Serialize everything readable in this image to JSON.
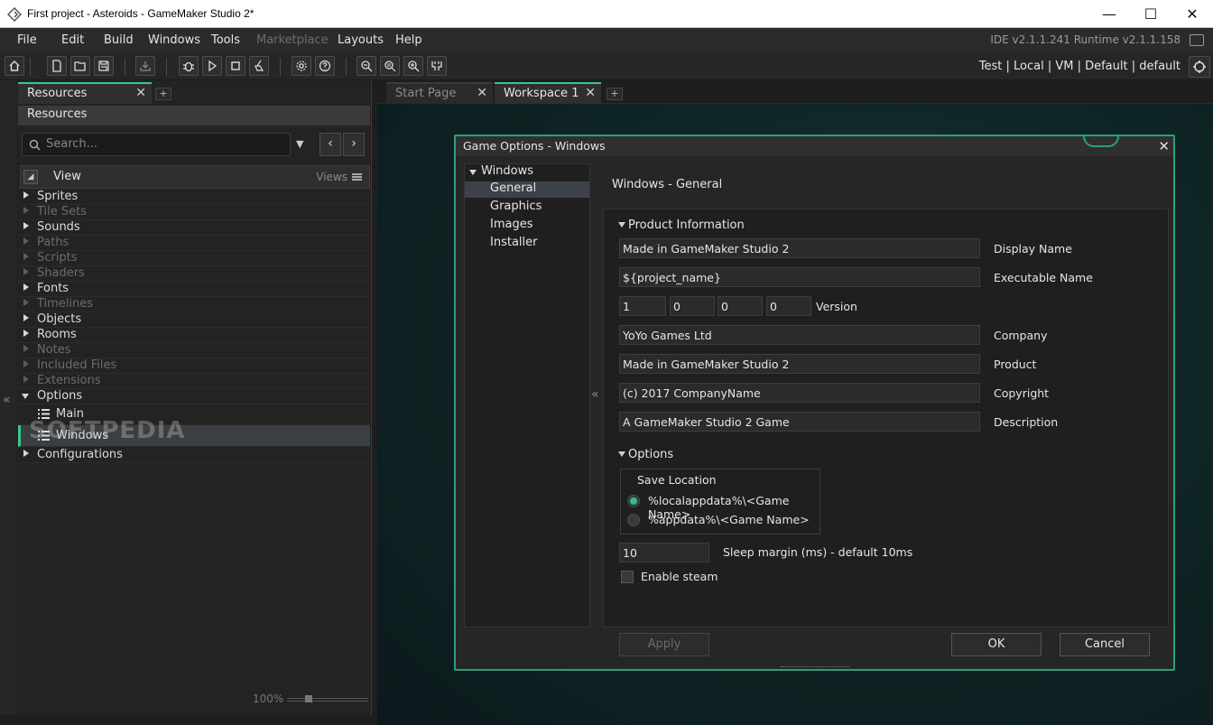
{
  "window": {
    "title": "First project - Asteroids - GameMaker Studio 2*",
    "minimize": "—",
    "maximize": "☐",
    "close": "✕"
  },
  "menu": {
    "items": [
      "File",
      "Edit",
      "Build",
      "Windows",
      "Tools",
      "Marketplace",
      "Layouts",
      "Help"
    ],
    "version": "IDE v2.1.1.241 Runtime v2.1.1.158"
  },
  "toolbar": {
    "target_label": "Test  |  Local  |  VM  |  Default  |  default",
    "icons": [
      "home-icon",
      "new-file-icon",
      "open-folder-icon",
      "save-icon",
      "create-exe-icon",
      "debug-icon",
      "run-icon",
      "stop-icon",
      "clean-icon",
      "settings-icon",
      "help-icon",
      "zoom-out-icon",
      "zoom-reset-icon",
      "zoom-in-icon",
      "game-options-icon"
    ]
  },
  "left_panel": {
    "tab_label": "Resources",
    "header": "Resources",
    "search_placeholder": "Search...",
    "view_label": "View",
    "views_label": "Views",
    "tree": [
      {
        "label": "Sprites",
        "enabled": true
      },
      {
        "label": "Tile Sets",
        "enabled": false
      },
      {
        "label": "Sounds",
        "enabled": true
      },
      {
        "label": "Paths",
        "enabled": false
      },
      {
        "label": "Scripts",
        "enabled": false
      },
      {
        "label": "Shaders",
        "enabled": false
      },
      {
        "label": "Fonts",
        "enabled": true
      },
      {
        "label": "Timelines",
        "enabled": false
      },
      {
        "label": "Objects",
        "enabled": true
      },
      {
        "label": "Rooms",
        "enabled": true
      },
      {
        "label": "Notes",
        "enabled": false
      },
      {
        "label": "Included Files",
        "enabled": false
      },
      {
        "label": "Extensions",
        "enabled": false
      },
      {
        "label": "Options",
        "enabled": true,
        "open": true
      }
    ],
    "options_children": [
      "Main",
      "Windows"
    ],
    "configurations": "Configurations",
    "watermark": "SOFTPEDIA",
    "zoom": "100%"
  },
  "workspace": {
    "tabs": [
      {
        "label": "Start Page",
        "active": false
      },
      {
        "label": "Workspace 1",
        "active": true
      }
    ]
  },
  "dialog": {
    "title": "Game Options - Windows",
    "nav_root": "Windows",
    "nav_items": [
      "General",
      "Graphics",
      "Images",
      "Installer"
    ],
    "heading": "Windows - General",
    "product_section": "Product Information",
    "display_name": {
      "value": "Made in GameMaker Studio 2",
      "label": "Display Name"
    },
    "executable_name": {
      "value": "${project_name}",
      "label": "Executable Name"
    },
    "version": {
      "parts": [
        "1",
        "0",
        "0",
        "0"
      ],
      "label": "Version"
    },
    "company": {
      "value": "YoYo Games Ltd",
      "label": "Company"
    },
    "product": {
      "value": "Made in GameMaker Studio 2",
      "label": "Product"
    },
    "copyright": {
      "value": "(c) 2017 CompanyName",
      "label": "Copyright"
    },
    "description": {
      "value": "A GameMaker Studio 2 Game",
      "label": "Description"
    },
    "options_section": "Options",
    "save_location_label": "Save Location",
    "save_options": [
      "%localappdata%\\<Game Name>",
      "%appdata%\\<Game Name>"
    ],
    "sleep_margin": {
      "value": "10",
      "label": "Sleep margin (ms) - default 10ms"
    },
    "enable_steam": "Enable steam",
    "buttons": {
      "apply": "Apply",
      "ok": "OK",
      "cancel": "Cancel"
    }
  },
  "colors": {
    "accent": "#34c98e",
    "dialog_border": "#2ba07a"
  }
}
